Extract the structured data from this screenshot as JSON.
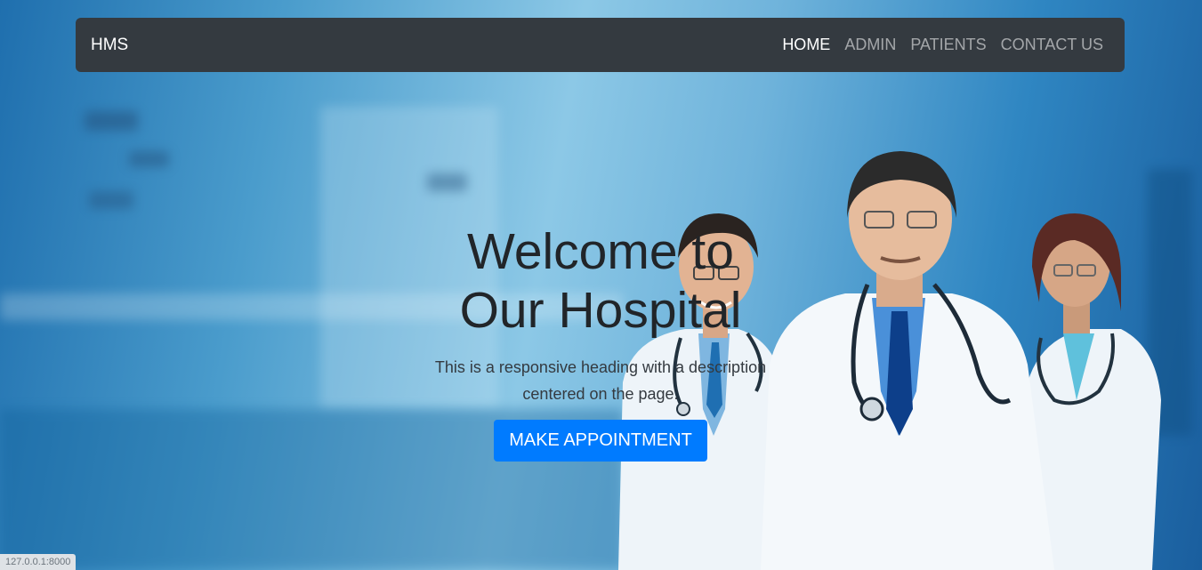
{
  "navbar": {
    "brand": "HMS",
    "links": [
      "HOME",
      "ADMIN",
      "PATIENTS",
      "CONTACT US"
    ]
  },
  "hero": {
    "title_line1": "Welcome to",
    "title_line2": "Our Hospital",
    "description": "This is a responsive heading with a description centered on the page.",
    "button_label": "MAKE APPOINTMENT"
  },
  "status_bar": {
    "url": "127.0.0.1:8000"
  },
  "colors": {
    "navbar_bg": "#343a40",
    "primary_button": "#007bff",
    "hero_blue": "#4a9ccc"
  }
}
